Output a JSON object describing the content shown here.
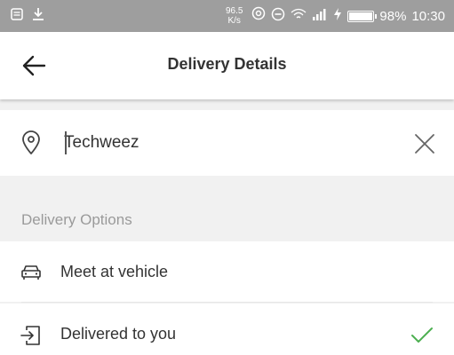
{
  "status_bar": {
    "speed_value": "96.5",
    "speed_unit": "K/s",
    "battery_percent": "98%",
    "battery_level": 0.98,
    "time": "10:30"
  },
  "app_bar": {
    "title": "Delivery Details"
  },
  "address": {
    "value": "Techweez"
  },
  "delivery_options": {
    "section_label": "Delivery Options",
    "items": [
      {
        "label": "Meet at vehicle",
        "icon": "car-icon",
        "selected": false
      },
      {
        "label": "Delivered to you",
        "icon": "door-enter-icon",
        "selected": true
      }
    ]
  },
  "colors": {
    "status_bar_bg": "#9e9e9e",
    "check_green": "#4caf50"
  }
}
